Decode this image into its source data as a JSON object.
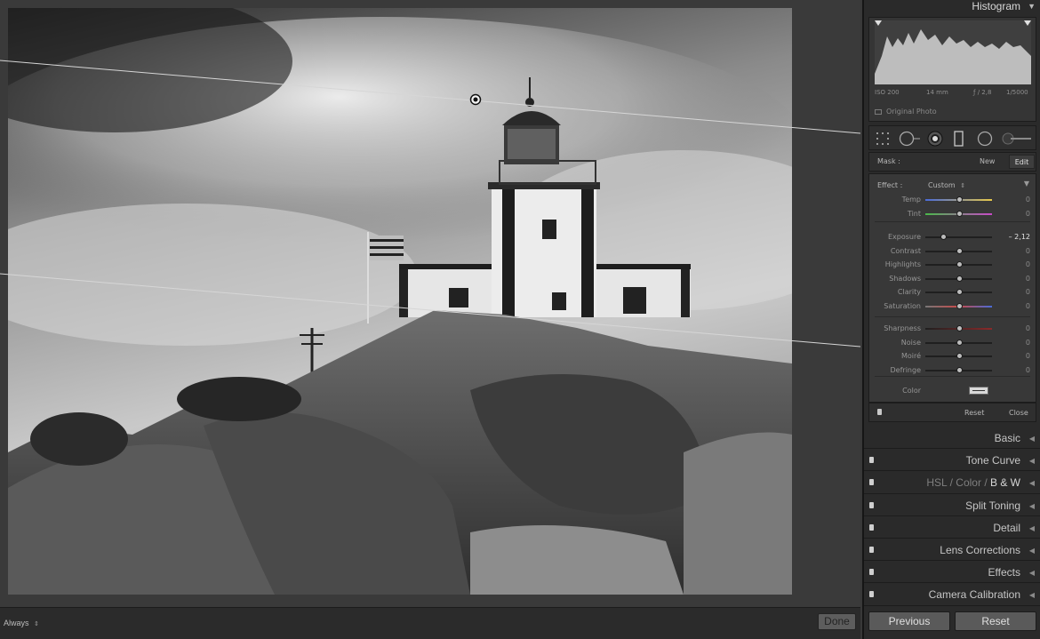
{
  "histogram": {
    "title": "Histogram",
    "iso": "ISO 200",
    "focal_length": "14 mm",
    "aperture": "ƒ / 2,8",
    "shutter": "1/5000",
    "original_photo_label": "Original Photo"
  },
  "mask": {
    "label": "Mask :",
    "new_label": "New",
    "edit_label": "Edit"
  },
  "effect": {
    "label": "Effect :",
    "value": "Custom",
    "sliders_group1": [
      {
        "name": "Temp",
        "value": "0",
        "pos": 0.5
      },
      {
        "name": "Tint",
        "value": "0",
        "pos": 0.5
      }
    ],
    "sliders_group2": [
      {
        "name": "Exposure",
        "value": "– 2,12",
        "pos": 0.27
      },
      {
        "name": "Contrast",
        "value": "0",
        "pos": 0.5
      },
      {
        "name": "Highlights",
        "value": "0",
        "pos": 0.5
      },
      {
        "name": "Shadows",
        "value": "0",
        "pos": 0.5
      },
      {
        "name": "Clarity",
        "value": "0",
        "pos": 0.5
      },
      {
        "name": "Saturation",
        "value": "0",
        "pos": 0.5
      }
    ],
    "sliders_group3": [
      {
        "name": "Sharpness",
        "value": "0",
        "pos": 0.5
      },
      {
        "name": "Noise",
        "value": "0",
        "pos": 0.5
      },
      {
        "name": "Moiré",
        "value": "0",
        "pos": 0.5
      },
      {
        "name": "Defringe",
        "value": "0",
        "pos": 0.5
      }
    ],
    "color_label": "Color",
    "reset_label": "Reset",
    "close_label": "Close"
  },
  "sections": {
    "basic": "Basic",
    "tone_curve": "Tone Curve",
    "hsl": "HSL",
    "color": "Color",
    "bw": "B & W",
    "split_toning": "Split Toning",
    "detail": "Detail",
    "lens_corrections": "Lens Corrections",
    "effects": "Effects",
    "camera_calibration": "Camera Calibration"
  },
  "toolbar": {
    "mode_label": "Always",
    "done_label": "Done"
  },
  "bottom": {
    "previous_label": "Previous",
    "reset_label": "Reset"
  },
  "colors": {
    "panel_bg": "#2a2a2a",
    "canvas_bg": "#3a3a3a",
    "accent_knob": "#bdbdbd"
  }
}
